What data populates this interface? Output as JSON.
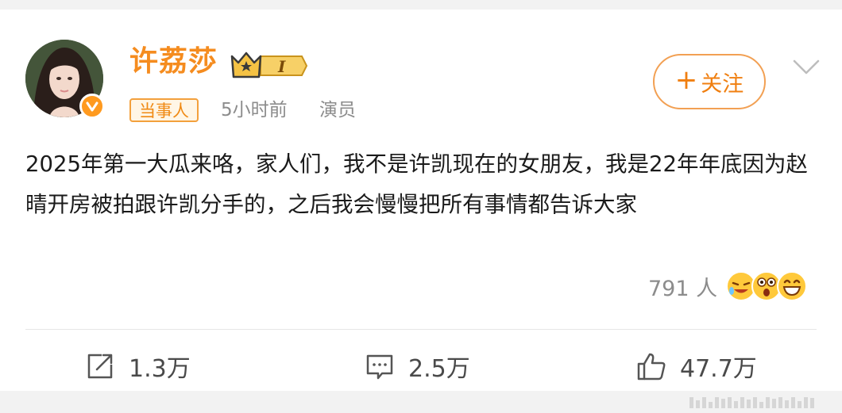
{
  "author": {
    "name": "许荔莎",
    "tag": "当事人",
    "time": "5小时前",
    "role": "演员",
    "vip_level": "I"
  },
  "follow_button": {
    "plus": "+",
    "label": "关注"
  },
  "post": {
    "text": "2025年第一大瓜来咯，家人们，我不是许凯现在的女朋友，我是22年年底因为赵晴开房被拍跟许凯分手的，之后我会慢慢把所有事情都告诉大家"
  },
  "reactions": {
    "count": "791 人",
    "emojis": [
      "laughing-crying-icon",
      "shocked-icon",
      "grinning-icon"
    ]
  },
  "actions": {
    "repost": "1.3万",
    "comment": "2.5万",
    "like": "47.7万"
  },
  "colors": {
    "name": "#f58c1f",
    "accent": "#f07f10",
    "verified": "#ff9a1f"
  }
}
